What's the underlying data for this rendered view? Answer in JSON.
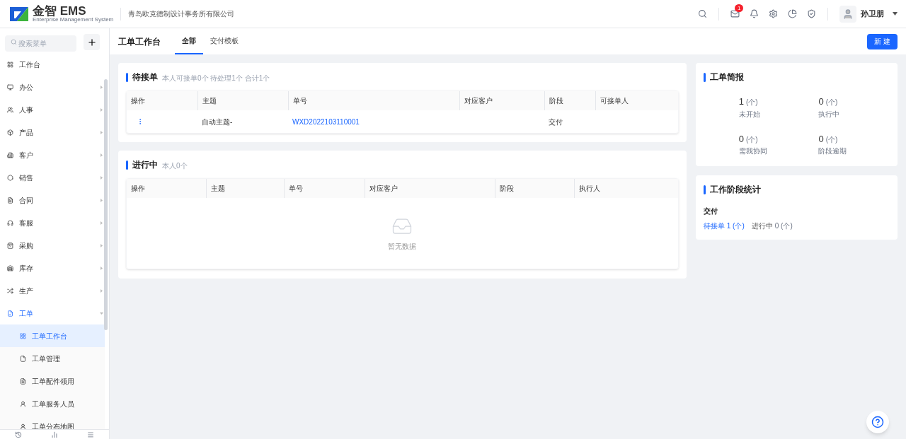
{
  "header": {
    "logo_text": "金智 EMS",
    "logo_subtitle": "Enterprise Management System",
    "company": "青岛欧克德制设计事务所有限公司",
    "message_badge": "1",
    "user_name": "孙卫朋"
  },
  "sidebar": {
    "search_placeholder": "搜索菜单",
    "items": [
      {
        "label": "工作台",
        "expandable": false,
        "expanded": false,
        "selected": false
      },
      {
        "label": "办公",
        "expandable": true,
        "expanded": false,
        "selected": false
      },
      {
        "label": "人事",
        "expandable": true,
        "expanded": false,
        "selected": false
      },
      {
        "label": "产品",
        "expandable": true,
        "expanded": false,
        "selected": false
      },
      {
        "label": "客户",
        "expandable": true,
        "expanded": false,
        "selected": false
      },
      {
        "label": "销售",
        "expandable": true,
        "expanded": false,
        "selected": false
      },
      {
        "label": "合同",
        "expandable": true,
        "expanded": false,
        "selected": false
      },
      {
        "label": "客服",
        "expandable": true,
        "expanded": false,
        "selected": false
      },
      {
        "label": "采购",
        "expandable": true,
        "expanded": false,
        "selected": false
      },
      {
        "label": "库存",
        "expandable": true,
        "expanded": false,
        "selected": false
      },
      {
        "label": "生产",
        "expandable": true,
        "expanded": false,
        "selected": false
      },
      {
        "label": "工单",
        "expandable": true,
        "expanded": true,
        "selected": true,
        "children": [
          {
            "label": "工单工作台",
            "selected": true
          },
          {
            "label": "工单管理",
            "selected": false
          },
          {
            "label": "工单配件领用",
            "selected": false
          },
          {
            "label": "工单服务人员",
            "selected": false
          },
          {
            "label": "工单分布地图",
            "selected": false
          }
        ]
      }
    ]
  },
  "page": {
    "title": "工单工作台",
    "tabs": [
      {
        "label": "全部",
        "selected": true
      },
      {
        "label": "交付模板",
        "selected": false
      }
    ],
    "new_button": "新 建"
  },
  "pending": {
    "title": "待接单",
    "subtitle": "本人可接单0个 待处理1个 合计1个",
    "columns": [
      "操作",
      "主题",
      "单号",
      "对应客户",
      "阶段",
      "可接单人"
    ],
    "rows": [
      {
        "subject": "自动主题-",
        "number": "WXD2022103110001",
        "customer": "",
        "stage": "交付",
        "receiver": ""
      }
    ]
  },
  "in_progress": {
    "title": "进行中",
    "subtitle": "本人0个",
    "columns": [
      "操作",
      "主题",
      "单号",
      "对应客户",
      "阶段",
      "执行人"
    ],
    "empty_text": "暂无数据"
  },
  "brief": {
    "title": "工单简报",
    "stats": [
      {
        "value": "1",
        "unit": "(个)",
        "label": "未开始"
      },
      {
        "value": "0",
        "unit": "(个)",
        "label": "执行中"
      },
      {
        "value": "0",
        "unit": "(个)",
        "label": "需我协同"
      },
      {
        "value": "0",
        "unit": "(个)",
        "label": "阶段逾期"
      }
    ]
  },
  "stage_stats": {
    "title": "工作阶段统计",
    "stage": "交付",
    "items": [
      {
        "label": "待接单",
        "count": "1 (个)",
        "highlighted": true
      },
      {
        "label": "进行中",
        "count": "0 (个)",
        "highlighted": false
      }
    ]
  }
}
